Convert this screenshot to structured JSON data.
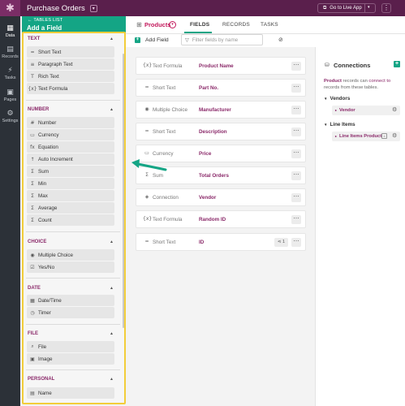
{
  "app": {
    "title": "Purchase Orders",
    "caret": "▾",
    "go_live": "Go to Live App",
    "go_live_icon": "external-link-icon",
    "go_live_caret": "▾",
    "more": "⋮"
  },
  "rail": [
    {
      "icon": "▦",
      "label": "Data",
      "active": true
    },
    {
      "icon": "▤",
      "label": "Records",
      "active": false
    },
    {
      "icon": "⚡",
      "label": "Tasks",
      "active": false
    },
    {
      "icon": "▣",
      "label": "Pages",
      "active": false
    },
    {
      "icon": "⚙",
      "label": "Settings",
      "active": false
    }
  ],
  "panel": {
    "back_label": "← TABLES LIST",
    "title": "Add a Field",
    "sections": [
      {
        "title": "TEXT",
        "items": [
          {
            "icon": "═",
            "label": "Short Text"
          },
          {
            "icon": "≡",
            "label": "Paragraph Text"
          },
          {
            "icon": "T",
            "label": "Rich Text"
          },
          {
            "icon": "{x}",
            "label": "Text Formula"
          }
        ]
      },
      {
        "title": "NUMBER",
        "items": [
          {
            "icon": "#",
            "label": "Number"
          },
          {
            "icon": "▭",
            "label": "Currency"
          },
          {
            "icon": "fx",
            "label": "Equation"
          },
          {
            "icon": "↑",
            "label": "Auto Increment"
          },
          {
            "icon": "Σ",
            "label": "Sum"
          },
          {
            "icon": "Σ",
            "label": "Min"
          },
          {
            "icon": "Σ",
            "label": "Max"
          },
          {
            "icon": "Σ",
            "label": "Average"
          },
          {
            "icon": "Σ",
            "label": "Count"
          }
        ]
      },
      {
        "title": "CHOICE",
        "items": [
          {
            "icon": "◉",
            "label": "Multiple Choice"
          },
          {
            "icon": "☑",
            "label": "Yes/No"
          }
        ]
      },
      {
        "title": "DATE",
        "items": [
          {
            "icon": "▦",
            "label": "Date/Time"
          },
          {
            "icon": "◷",
            "label": "Timer"
          }
        ]
      },
      {
        "title": "FILE",
        "items": [
          {
            "icon": "⌕",
            "label": "File"
          },
          {
            "icon": "▣",
            "label": "Image"
          }
        ]
      },
      {
        "title": "PERSONAL",
        "items": [
          {
            "icon": "▤",
            "label": "Name"
          }
        ]
      }
    ],
    "caret": "▲"
  },
  "header": {
    "table_name": "Products",
    "table_caret": "▾",
    "tabs": [
      "FIELDS",
      "RECORDS",
      "TASKS"
    ],
    "active_tab": "FIELDS"
  },
  "toolbar": {
    "add_field": "Add Field",
    "add_icon": "+",
    "filter_placeholder": "Filter fields by name",
    "filter_icon": "▽",
    "filter_btn_icon": "⊘"
  },
  "fields": [
    {
      "icon": "{x}",
      "type": "Text Formula",
      "name": "Product Name",
      "links": ""
    },
    {
      "icon": "═",
      "type": "Short Text",
      "name": "Part No.",
      "links": ""
    },
    {
      "icon": "◉",
      "type": "Multiple Choice",
      "name": "Manufacturer",
      "links": ""
    },
    {
      "icon": "═",
      "type": "Short Text",
      "name": "Description",
      "links": ""
    },
    {
      "icon": "▭",
      "type": "Currency",
      "name": "Price",
      "links": ""
    },
    {
      "icon": "Σ",
      "type": "Sum",
      "name": "Total Orders",
      "links": ""
    },
    {
      "icon": "◈",
      "type": "Connection",
      "name": "Vendor",
      "links": ""
    },
    {
      "icon": "{x}",
      "type": "Text Formula",
      "name": "Random ID",
      "links": ""
    },
    {
      "icon": "═",
      "type": "Short Text",
      "name": "ID",
      "links": "⋖ 1"
    }
  ],
  "row_more": "⋯",
  "connections": {
    "title": "Connections",
    "add": "+",
    "desc_product": "Product",
    "desc_mid": " records can ",
    "desc_link": "connect to",
    "desc_end": " records from these tables.",
    "groups": [
      {
        "name": "Vendors",
        "items": [
          {
            "label": "Vendor",
            "extra": ""
          }
        ]
      },
      {
        "name": "Line Items",
        "items": [
          {
            "label": "Line Items Product",
            "extra": "×"
          }
        ]
      }
    ],
    "group_caret": "▼",
    "item_caret": "▸",
    "gear": "⚙"
  },
  "highlight_color": "#f2cd3a",
  "accent_color": "#14a585",
  "brand_color": "#5a1f4c"
}
